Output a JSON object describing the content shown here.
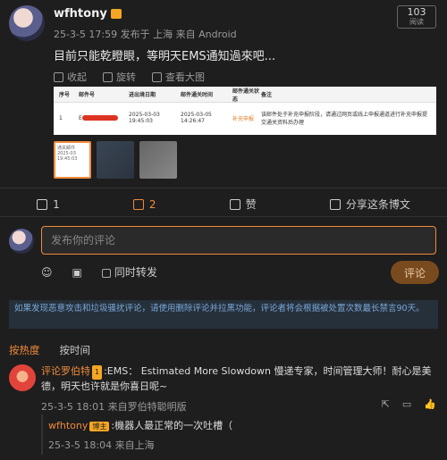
{
  "post": {
    "username": "wfhtony",
    "meta": "25-3-5 17:59 发布于 上海 来自 Android",
    "views_count": "103",
    "views_label": "阅读",
    "text": "目前只能乾瞪眼，等明天EMS通知過來吧...",
    "img_tools": {
      "collapse": "收起",
      "rotate": "旋转",
      "view": "查看大图"
    },
    "table": {
      "headers": [
        "序号",
        "邮件号",
        "进出境日期",
        "邮件通关时间",
        "邮件通关状态",
        "备注"
      ],
      "row": [
        "1",
        "E",
        "2025-03-03 19:45:03",
        "2025-03-05 14:26:47",
        "补充申报",
        "该邮件处于补充申报阶段，请通过网页或线上申报通道进行补充申报提交通关资料后办理"
      ]
    },
    "thumb1_text": "通关邮件 2025-03 19:45:03"
  },
  "actions": {
    "repost": "1",
    "comment": "2",
    "like": "赞",
    "share": "分享这条博文"
  },
  "composer": {
    "placeholder": "发布你的评论",
    "also_repost": "同时转发",
    "submit": "评论"
  },
  "notice": "如果发现恶意攻击和垃圾骚扰评论，请使用删除评论并拉黑功能，评论者将会根据被处置次数最长禁言90天。",
  "tabs": {
    "hot": "按热度",
    "time": "按时间"
  },
  "comment": {
    "name": "评论罗伯特",
    "badge": "1",
    "text": ":EMS： Estimated More Slowdown  慢递专家，时间管理大师！耐心是美德，明天也许就是你喜日呢~",
    "meta": "25-3-5 18:01 来自罗伯特聪明版"
  },
  "reply": {
    "name": "wfhtony",
    "badge": "博主",
    "text": ":機器人最正常的一次吐槽（",
    "meta": "25-3-5 18:04 来自上海"
  },
  "colors": {
    "accent": "#f08a3a",
    "bg": "#1e1e1e"
  }
}
